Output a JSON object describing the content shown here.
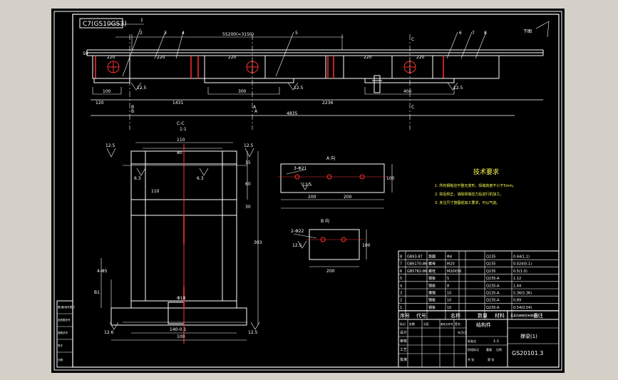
{
  "drawing": {
    "title_tag": "C7(GS10GS3)",
    "top_view": {
      "part_numbers": [
        "1",
        "2",
        "3",
        "4",
        "5",
        "6",
        "7",
        "8"
      ],
      "total_dim": "55200(=3150)",
      "dim_left_small": "50",
      "dims_spacing": [
        "220",
        "220",
        "220",
        "220",
        "220"
      ],
      "dims_pads": [
        "100",
        "300",
        "400"
      ],
      "bottom_dims": [
        "120",
        "1431",
        "2236"
      ],
      "total_length": "4835",
      "roughness": [
        "12.5",
        "12.5",
        "12.5"
      ],
      "section_marks": [
        "B",
        "A",
        "C",
        "A",
        "B",
        "C"
      ],
      "marker_right": "下图"
    },
    "section_cc": {
      "title": "C-C",
      "scale": "1:1",
      "dims_top": [
        "110",
        "80"
      ],
      "dims_side": [
        "15",
        "60",
        "30",
        "303"
      ],
      "dim_mid": "110",
      "dim_bottom": "100",
      "dim_bottom_sub": "140-0.1",
      "dim_left": "B1",
      "dim_left_hole": "4-Φ5",
      "center_hole": "Φ18",
      "roughness": [
        "12.5",
        "12.5",
        "6.3",
        "6.3",
        "12.6",
        "12.5"
      ]
    },
    "view_a": {
      "title": "A 向",
      "holes": "3-Φ21",
      "roughness": "12.5",
      "dims": [
        "200",
        "200"
      ],
      "height": "100"
    },
    "view_b": {
      "title": "B 向",
      "holes": "2-Φ22",
      "roughness": "12.5",
      "dim_width": "100",
      "dim_bottom": "200"
    },
    "tech_requirements": {
      "title": "技术要求",
      "items": [
        "1. 所有钢板应平整无变形，焊缝高度不小于5mm。",
        "2. 焊后校正，消除焊接应力后进行机加工。",
        "3. 未注尺寸按图纸加工要求，可以气割。"
      ]
    },
    "parts_list": {
      "rows": [
        [
          "8",
          "GB93-87",
          "垫圈",
          "Φ4",
          "",
          "",
          "Q235",
          "0.44(1.1)"
        ],
        [
          "7",
          "GB6170-86",
          "螺母",
          "M20",
          "",
          "",
          "Q235",
          "0.024(0.1)"
        ],
        [
          "6",
          "GB5782-86",
          "螺栓",
          "M20X50",
          "",
          "",
          "Q235",
          "0.5(1.0)"
        ],
        [
          "5",
          "",
          "钢板",
          "5",
          "",
          "",
          "Q235-A",
          "1.12"
        ],
        [
          "4",
          "",
          "钢板",
          "8",
          "",
          "",
          "Q235-A",
          "1.44"
        ],
        [
          "3",
          "",
          "槽钢",
          "10",
          "",
          "",
          "Q235-A",
          "5.36(5.36)"
        ],
        [
          "2",
          "",
          "钢板",
          "10",
          "",
          "",
          "Q235-A",
          "0.89"
        ],
        [
          "1",
          "",
          "钢板",
          "10",
          "",
          "",
          "Q235-A",
          "0.54(0.54)"
        ]
      ],
      "header": [
        "序号",
        "代号",
        "名称",
        "数量",
        "材料",
        "备注"
      ]
    },
    "title_block": {
      "part_name": "结构件",
      "drawing_name": "撑梁(1)",
      "drawing_no": "GS20101.3",
      "company": "某某机械制造有限公司",
      "scale": "1:1",
      "rows_left": [
        "标记",
        "处数",
        "分区",
        "更改文件号",
        "签名",
        "年月日"
      ],
      "roles": [
        "设计",
        "审核",
        "工艺",
        "批准"
      ],
      "labels": [
        "标准化",
        "阶段标记",
        "重量",
        "比例",
        "共 张",
        "第 张"
      ]
    },
    "side_stamp": [
      "借(通)用件登记",
      "旧底图总号",
      "底图总号",
      "签字",
      "日期"
    ]
  }
}
